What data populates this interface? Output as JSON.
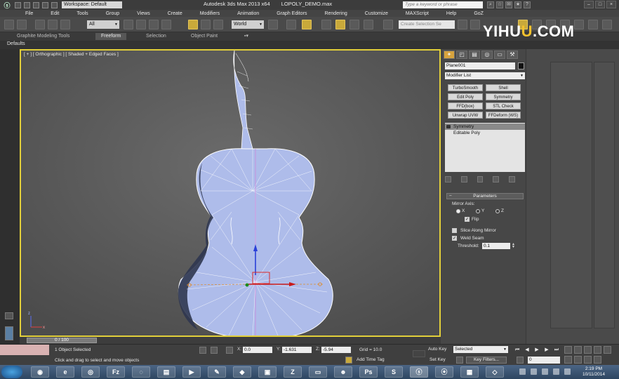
{
  "titlebar": {
    "workspace": "Workspace: Default",
    "app_name": "Autodesk 3ds Max  2013 x64",
    "file_name": "LOPOLY_DEMO.max",
    "help_search_placeholder": "Type a keyword or phrase"
  },
  "menu": [
    "File",
    "Edit",
    "Tools",
    "Group",
    "Views",
    "Create",
    "Modifiers",
    "Animation",
    "Graph Editors",
    "Rendering",
    "Customize",
    "MAXScript",
    "Help",
    "GoZ"
  ],
  "toolbar": {
    "selection_filter": "All",
    "reference_coord": "World",
    "named_selection_placeholder": "Create Selection Se"
  },
  "ribbon": {
    "tabs": [
      "Graphite Modeling Tools",
      "Freeform",
      "Selection",
      "Object Paint"
    ],
    "active_tab": "Freeform",
    "defaults_label": "Defaults"
  },
  "watermark": {
    "pre": "YIHU",
    "accent": "U",
    "post": ".COM"
  },
  "viewport": {
    "label": "[ + ] [ Orthographic ] [ Shaded + Edged Faces ]",
    "border_color": "#e2cf3a"
  },
  "command_panel": {
    "object_name": "Plane001",
    "modifier_list": "Modifier List",
    "modifier_buttons": [
      "TurboSmooth",
      "Shell",
      "Edit Poly",
      "Symmetry",
      "FFD(box)",
      "STL Check",
      "Unwrap UVW",
      "FFDeform (WS)"
    ],
    "stack": [
      "Symmetry",
      "Editable Poly"
    ],
    "parameters": {
      "title": "Parameters",
      "mirror_axis_label": "Mirror Axis:",
      "axes": [
        "X",
        "Y",
        "Z"
      ],
      "selected_axis": "X",
      "flip_label": "Flip",
      "flip_checked": true,
      "slice_label": "Slice Along Mirror",
      "slice_checked": false,
      "weld_label": "Weld Seam",
      "weld_checked": true,
      "threshold_label": "Threshold:",
      "threshold_value": "0.1"
    }
  },
  "timeline": {
    "frame_label": "0 / 100"
  },
  "status": {
    "selection_count": "1 Object Selected",
    "prompt": "Click and drag to select and move objects",
    "x_label": "X:",
    "x_value": "0.0",
    "y_label": "Y:",
    "y_value": "-1.631",
    "z_label": "Z:",
    "z_value": "-5.94",
    "grid": "Grid = 10.0",
    "add_time_tag": "Add Time Tag",
    "auto_key": "Auto Key",
    "set_key": "Set Key",
    "key_mode": "Selected",
    "key_filters": "Key Filters...",
    "current_frame": "0"
  },
  "taskbar": {
    "time": "2:19 PM",
    "date": "10/11/2014"
  }
}
